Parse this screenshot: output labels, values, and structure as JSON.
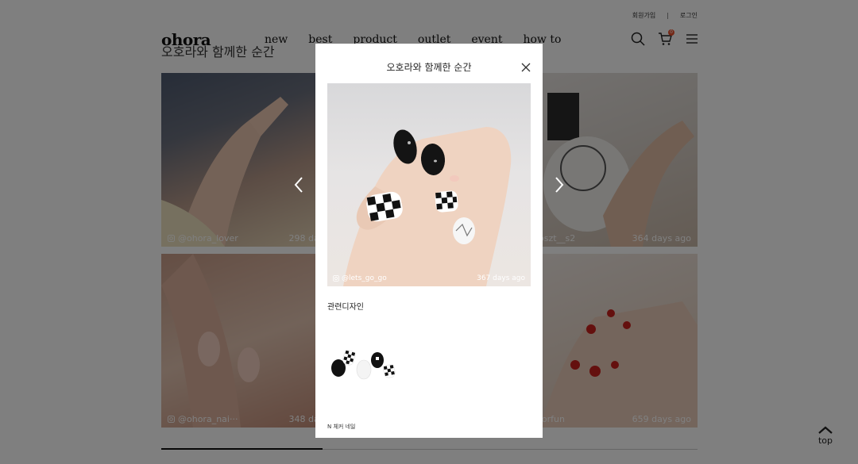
{
  "top_links": {
    "signup": "회원가입",
    "separator": "|",
    "login": "로그인"
  },
  "logo": "ohora",
  "nav": [
    "new",
    "best",
    "product",
    "outlet",
    "event",
    "how to"
  ],
  "header_icons": {
    "search": "search-icon",
    "cart": "cart-icon",
    "menu": "menu-icon",
    "cart_count": "0"
  },
  "section_title": "오호라와 함께한 순간",
  "tiles": [
    {
      "user": "@ohora_lover",
      "days": "298 days"
    },
    {
      "user": "",
      "days": ""
    },
    {
      "user": "@oszt__s2",
      "days": "364 days ago"
    },
    {
      "user": "@ohora_nai···",
      "days": "348 days"
    },
    {
      "user": "",
      "days": ""
    },
    {
      "user": "@forfun",
      "days": "659 days ago"
    }
  ],
  "progress": {
    "fraction": 0.3
  },
  "top_button": "top",
  "modal": {
    "title": "오호라와 함께한 순간",
    "user": "@lets_go_go",
    "days": "367 days ago",
    "related_label": "관련디자인",
    "product_name": "N 체커 네일"
  },
  "colors": {
    "accent": "#e8502c",
    "overlay": "rgba(0,0,0,0.5)"
  }
}
